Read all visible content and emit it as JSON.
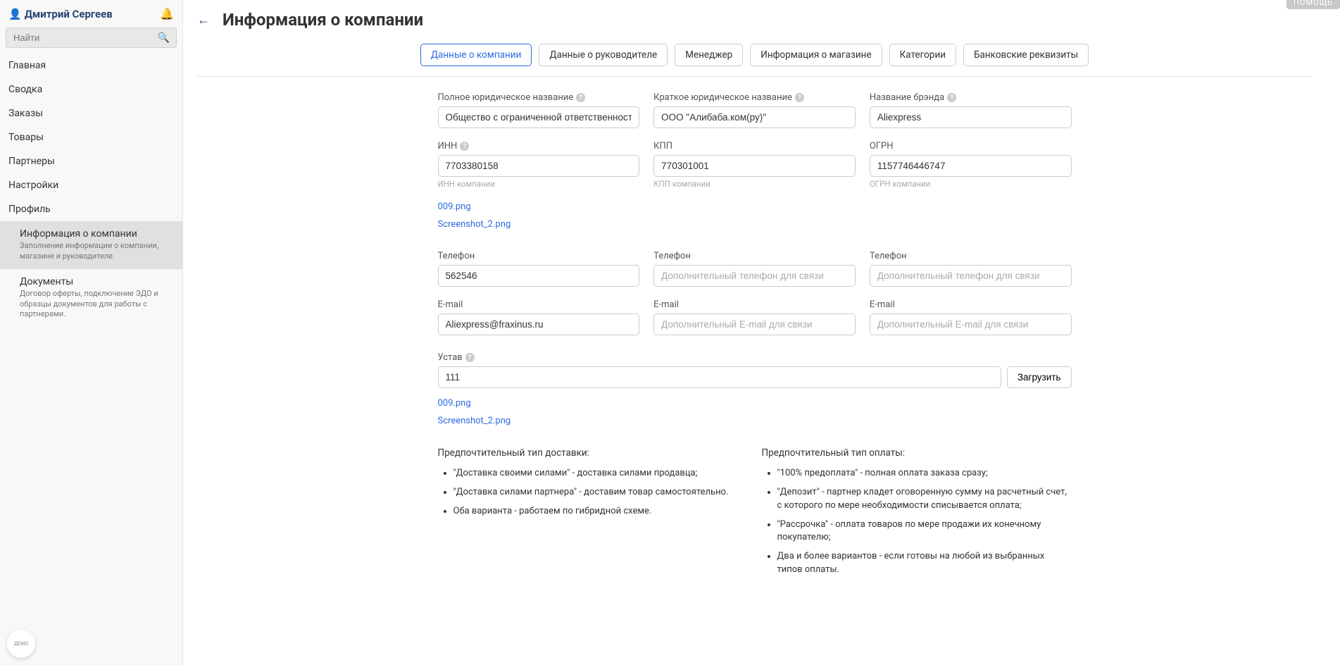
{
  "sidebar": {
    "user_name": "Дмитрий Сергеев",
    "search_placeholder": "Найти",
    "nav": [
      "Главная",
      "Сводка",
      "Заказы",
      "Товары",
      "Партнеры",
      "Настройки",
      "Профиль"
    ],
    "sub": [
      {
        "title": "Информация о компании",
        "desc": "Заполнение информации о компании, магазине и руководителе."
      },
      {
        "title": "Документы",
        "desc": "Договор оферты, подключение ЭДО и образцы документов для работы с партнерами."
      }
    ]
  },
  "header": {
    "back": "←",
    "title": "Информация о компании",
    "help": "ПОМОЩЬ"
  },
  "tabs": [
    "Данные о компании",
    "Данные о руководителе",
    "Менеджер",
    "Информация о магазине",
    "Категории",
    "Банковские реквизиты"
  ],
  "fields": {
    "full_name": {
      "label": "Полное юридическое название",
      "value": "Общество с ограниченной ответственностью \"Али"
    },
    "short_name": {
      "label": "Краткое юридическое название",
      "value": "ООО \"Алибаба.ком(ру)\""
    },
    "brand": {
      "label": "Название брэнда",
      "value": "Aliexpress"
    },
    "inn": {
      "label": "ИНН",
      "value": "7703380158",
      "hint": "ИНН компании"
    },
    "kpp": {
      "label": "КПП",
      "value": "770301001",
      "hint": "КПП компании"
    },
    "ogrn": {
      "label": "ОГРН",
      "value": "1157746446747",
      "hint": "ОГРН компании"
    },
    "files1": [
      "009.png",
      "Screenshot_2.png"
    ],
    "phone1": {
      "label": "Телефон",
      "value": "562546"
    },
    "phone2": {
      "label": "Телефон",
      "placeholder": "Дополнительный телефон для связи"
    },
    "phone3": {
      "label": "Телефон",
      "placeholder": "Дополнительный телефон для связи"
    },
    "email1": {
      "label": "E-mail",
      "value": "Aliexpress@fraxinus.ru"
    },
    "email2": {
      "label": "E-mail",
      "placeholder": "Дополнительный E-mail для связи"
    },
    "email3": {
      "label": "E-mail",
      "placeholder": "Дополнительный E-mail для связи"
    },
    "ustav": {
      "label": "Устав",
      "value": "111",
      "upload": "Загрузить"
    },
    "files2": [
      "009.png",
      "Screenshot_2.png"
    ]
  },
  "info": {
    "delivery_heading": "Предпочтительный тип доставки:",
    "delivery_items": [
      "\"Доставка своими силами\" - доставка силами продавца;",
      "\"Доставка силами партнера\" - доставим товар самостоятельно.",
      "Оба варианта - работаем по гибридной схеме."
    ],
    "payment_heading": "Предпочтительный тип оплаты:",
    "payment_items": [
      "\"100% предоплата\" - полная оплата заказа сразу;",
      "\"Депозит\" - партнер кладет оговоренную сумму на расчетный счет, с которого по мере необходимости списывается оплата;",
      "\"Рассрочка\" - оплата товаров по мере продажи их конечному покупателю;",
      "Два и более вариантов - если готовы на любой из выбранных типов оплаты."
    ]
  },
  "demo_badge": "ДЕМО"
}
